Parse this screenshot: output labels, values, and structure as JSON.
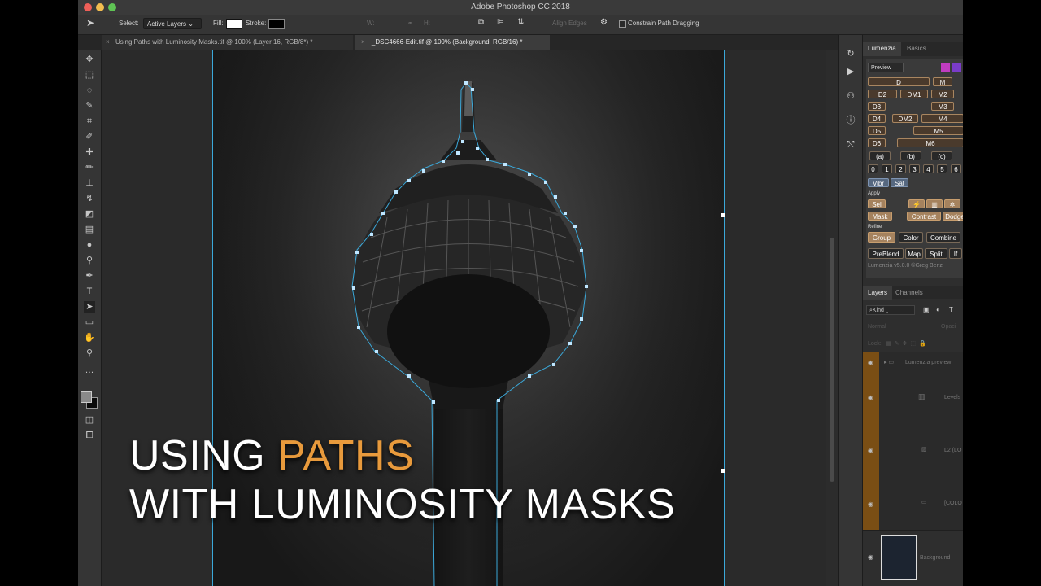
{
  "app": {
    "title": "Adobe Photoshop CC 2018"
  },
  "options_bar": {
    "select_label": "Select:",
    "select_value": "Active Layers",
    "fill_label": "Fill:",
    "stroke_label": "Stroke:",
    "w_label": "W:",
    "h_label": "H:",
    "align_edges": "Align Edges",
    "constrain": "Constrain Path Dragging"
  },
  "tabs": [
    {
      "label": "Using Paths with Luminosity Masks.tif @ 100% (Layer 16, RGB/8*) *"
    },
    {
      "label": "_DSC4666-Edit.tif @ 100% (Background, RGB/16) *"
    }
  ],
  "overlay": {
    "line1_a": "USING ",
    "line1_b": "PATHS",
    "line2": "WITH LUMINOSITY MASKS"
  },
  "panel": {
    "tab_active": "Lumenzia",
    "tab_other": "Basics",
    "preview": "Preview",
    "buttons": {
      "d": "D",
      "m": "M",
      "d2": "D2",
      "dm1": "DM1",
      "m2": "M2",
      "d3": "D3",
      "m3": "M3",
      "d4": "D4",
      "dm2": "DM2",
      "m4": "M4",
      "d5": "D5",
      "m5": "M5",
      "d6": "D6",
      "m6": "M6",
      "a": "(a)",
      "b": "(b)",
      "c": "(c)",
      "z0": "0",
      "z1": "1",
      "z2": "2",
      "z3": "3",
      "z4": "4",
      "z5": "5",
      "z6": "6",
      "vibr": "Vibr",
      "sat": "Sat",
      "sel": "Sel",
      "mask": "Mask",
      "contrast": "Contrast",
      "dodge": "Dodge",
      "group": "Group",
      "color": "Color",
      "combine": "Combine",
      "preblend": "PreBlend",
      "map": "Map",
      "split": "Split",
      "if": "If"
    },
    "apply_label": "Apply",
    "refine_label": "Refine",
    "version": "Lumenzia v5.0.0 ©Greg Benz",
    "swatch_colors": [
      "#c03cc0",
      "#7a3cc8"
    ]
  },
  "layers": {
    "tab_active": "Layers",
    "tab_other": "Channels",
    "filter": "Kind",
    "mode": "Normal",
    "opacity": "Opaci",
    "lock": "Lock:",
    "rows": [
      {
        "name": "Lumenzia preview"
      },
      {
        "name": "Levels"
      },
      {
        "name": "L2 (LO"
      },
      {
        "name": "[COLO"
      },
      {
        "name": "Background"
      }
    ]
  }
}
